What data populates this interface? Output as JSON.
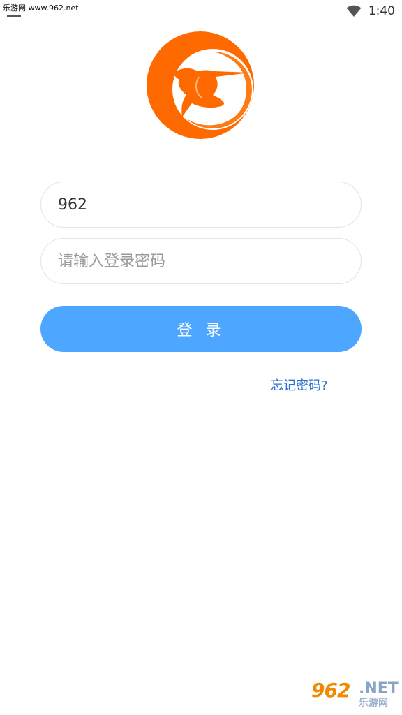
{
  "status_bar": {
    "watermark_text": "乐游网 www.962.net",
    "time": "1:40",
    "icons": [
      "wifi-icon"
    ]
  },
  "logo": {
    "name": "hummingbird-logo",
    "colors": {
      "primary": "#ff6a00",
      "secondary": "#ff8c1a"
    }
  },
  "form": {
    "account_value": "962",
    "password_placeholder": "请输入登录密码",
    "login_label": "登 录",
    "forgot_label": "忘记密码?"
  },
  "watermark": {
    "big": "962",
    "net": ".NET",
    "cn": "乐游网"
  },
  "colors": {
    "accent": "#4da6ff",
    "link": "#2f6fd0",
    "border": "#e3e3e3"
  }
}
